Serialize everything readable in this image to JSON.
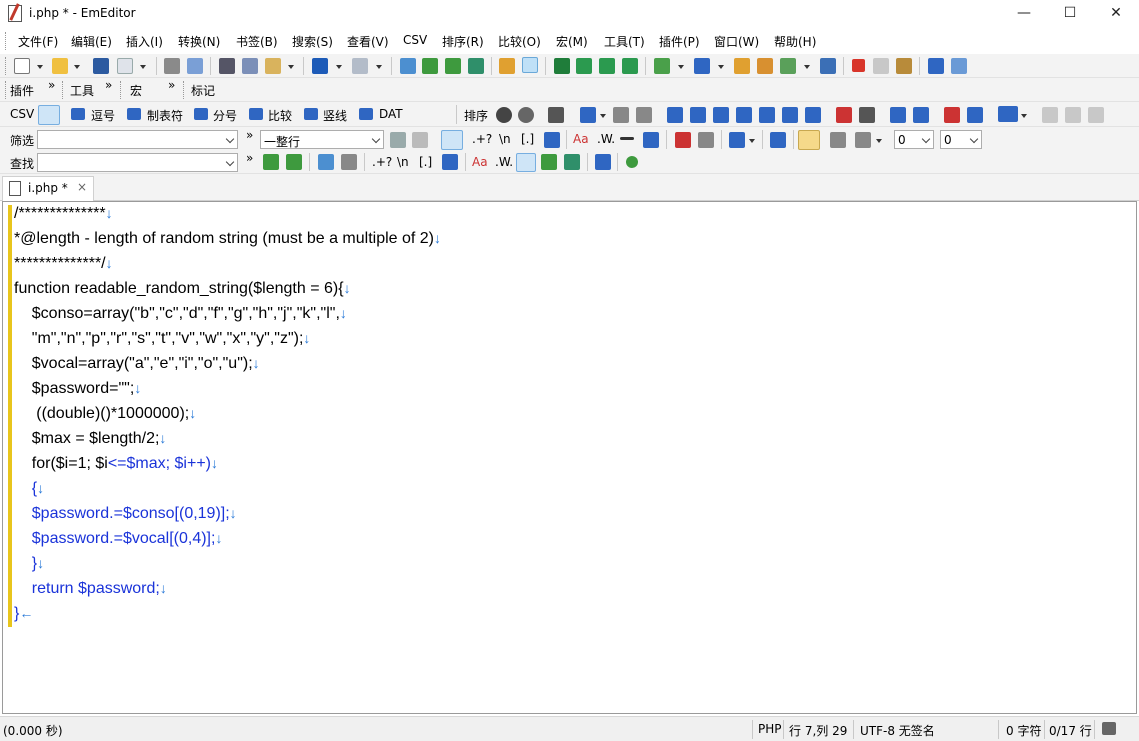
{
  "window": {
    "title": "i.php * - EmEditor",
    "minimize_glyph": "—",
    "maximize_glyph": "☐",
    "close_glyph": "✕"
  },
  "menu": [
    "文件(F)",
    "编辑(E)",
    "插入(I)",
    "转换(N)",
    "书签(B)",
    "搜索(S)",
    "查看(V)",
    "CSV",
    "排序(R)",
    "比较(O)",
    "宏(M)",
    "工具(T)",
    "插件(P)",
    "窗口(W)",
    "帮助(H)"
  ],
  "toolbar_row2": {
    "plugin_label": "插件",
    "tools_label": "工具",
    "macro_label": "宏",
    "marker_label": "标记",
    "overflow": "»"
  },
  "csv_bar": {
    "csv_label": "CSV",
    "comma_label": "逗号",
    "tab_label": "制表符",
    "semicolon_label": "分号",
    "compare_label": "比较",
    "pipe_label": "竖线",
    "dat_label": "DAT",
    "sort_label": "排序"
  },
  "filter_bar": {
    "label": "筛选",
    "value": "",
    "mode_value": "一整行",
    "regex_label": ".+?",
    "newline_label": "\\n",
    "bracket_label": "[.]",
    "case_label": "Aa",
    "word_label": ".W.",
    "num_a": "0",
    "num_b": "0"
  },
  "find_bar": {
    "label": "查找",
    "value": "",
    "regex_label": ".+?",
    "newline_label": "\\n",
    "bracket_label": "[.]",
    "case_label": "Aa",
    "word_label": ".W."
  },
  "tab": {
    "label": "i.php *",
    "close": "×"
  },
  "editor": {
    "eol": "↓",
    "eof": "←",
    "lines": [
      {
        "indent": "",
        "text": "/**************",
        "kw": ""
      },
      {
        "indent": "",
        "text": "*@length - length of random string (must be a multiple of 2)",
        "kw": ""
      },
      {
        "indent": "",
        "text": "**************/",
        "kw": ""
      },
      {
        "indent": "",
        "text": "function readable_random_string($length = 6){",
        "kw": ""
      },
      {
        "indent": "    ",
        "text": "$conso=array(\"b\",\"c\",\"d\",\"f\",\"g\",\"h\",\"j\",\"k\",\"l\",",
        "kw": ""
      },
      {
        "indent": "    ",
        "text": "\"m\",\"n\",\"p\",\"r\",\"s\",\"t\",\"v\",\"w\",\"x\",\"y\",\"z\");",
        "kw": ""
      },
      {
        "indent": "    ",
        "text": "$vocal=array(\"a\",\"e\",\"i\",\"o\",\"u\");",
        "kw": ""
      },
      {
        "indent": "    ",
        "text": "$password=\"\";",
        "kw": ""
      },
      {
        "indent": "     ",
        "text": "((double)()*1000000);",
        "kw": ""
      },
      {
        "indent": "    ",
        "text": "$max = $length/2;",
        "kw": ""
      },
      {
        "indent": "    ",
        "text": "for($i=1; $i",
        "kw": "<=$max; $i++)"
      },
      {
        "indent": "    ",
        "text": "",
        "kw": "{"
      },
      {
        "indent": "    ",
        "text": "",
        "kw": "$password.=$conso[(0,19)];"
      },
      {
        "indent": "    ",
        "text": "",
        "kw": "$password.=$vocal[(0,4)];"
      },
      {
        "indent": "    ",
        "text": "",
        "kw": "}"
      },
      {
        "indent": "    ",
        "text": "",
        "kw": "return $password;"
      },
      {
        "indent": "",
        "text": "",
        "kw": "}"
      }
    ]
  },
  "status": {
    "time": "(0.000 秒)",
    "lang": "PHP",
    "position": "行 7,列 29",
    "encoding": "UTF-8 无签名",
    "chars": "0 字符",
    "selection": "0/17 行"
  },
  "colors": {
    "keyword_blue": "#1a33d9",
    "eol_blue": "#2a7ad8",
    "marker_yellow": "#e8c51c",
    "toolbar_bg": "#f3f3f3"
  }
}
